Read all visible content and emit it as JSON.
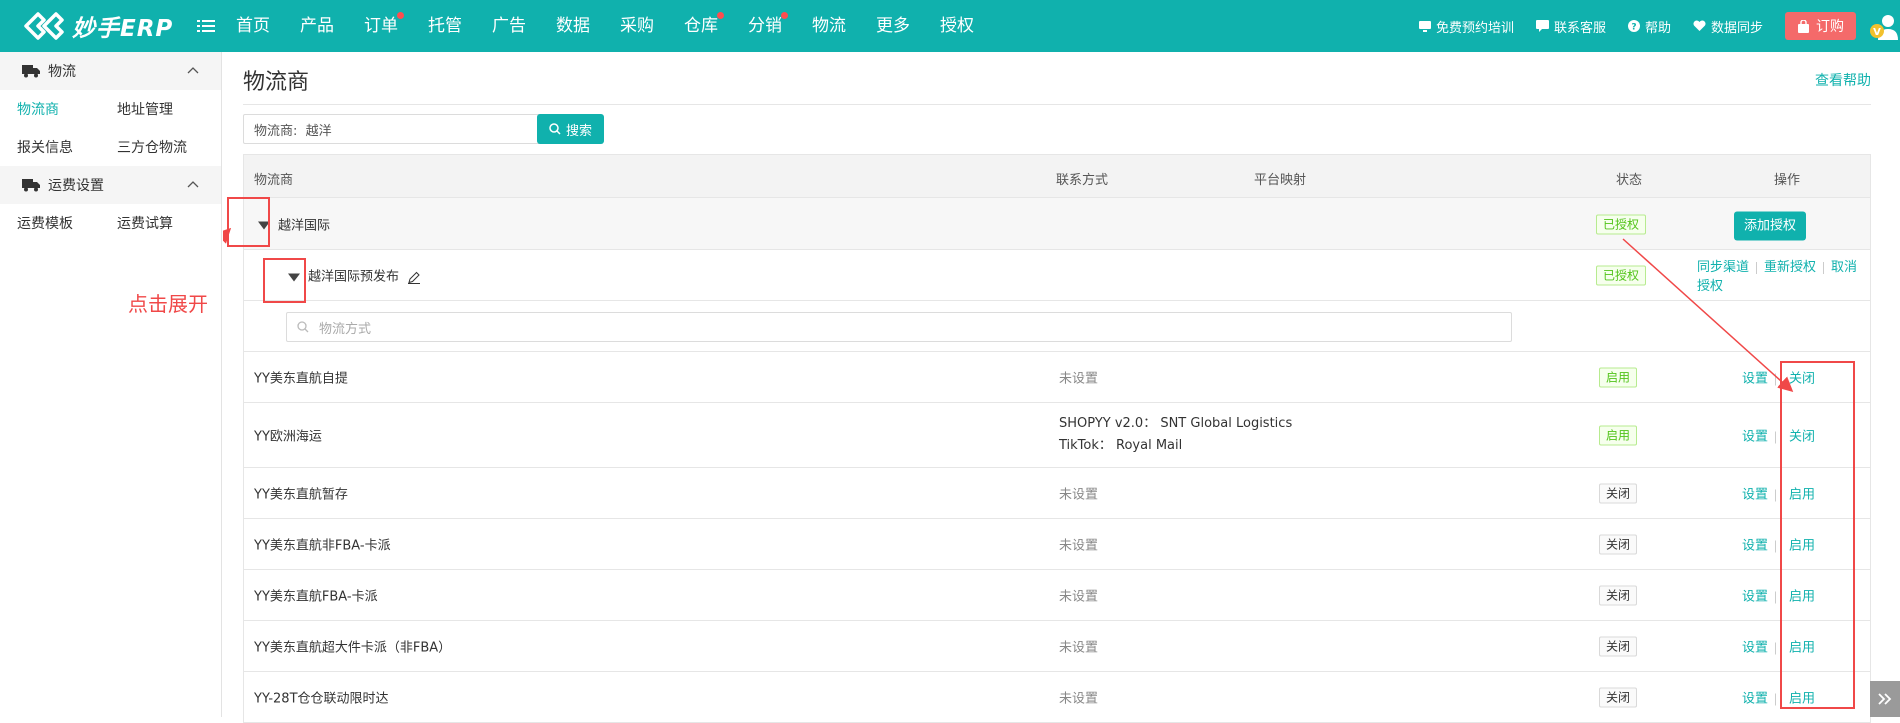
{
  "app": {
    "logo_text": "妙手ERP"
  },
  "nav": {
    "items": [
      {
        "label": "首页",
        "dot": false
      },
      {
        "label": "产品",
        "dot": false
      },
      {
        "label": "订单",
        "dot": true
      },
      {
        "label": "托管",
        "dot": false
      },
      {
        "label": "广告",
        "dot": false
      },
      {
        "label": "数据",
        "dot": false
      },
      {
        "label": "采购",
        "dot": false
      },
      {
        "label": "仓库",
        "dot": true
      },
      {
        "label": "分销",
        "dot": true
      },
      {
        "label": "物流",
        "dot": false
      },
      {
        "label": "更多",
        "dot": false
      },
      {
        "label": "授权",
        "dot": false
      }
    ]
  },
  "header_tools": {
    "training": "免费预约培训",
    "support": "联系客服",
    "help": "帮助",
    "sync": "数据同步",
    "order": "订购"
  },
  "sidebar": {
    "group1": "物流",
    "group1_links": [
      "物流商",
      "地址管理",
      "报关信息",
      "三方仓物流"
    ],
    "group2": "运费设置",
    "group2_links": [
      "运费模板",
      "运费试算"
    ]
  },
  "page": {
    "title": "物流商",
    "help_link": "查看帮助",
    "filter_label": "物流商:",
    "filter_value": "越洋",
    "search_button": "搜索"
  },
  "table": {
    "headers": {
      "carrier": "物流商",
      "contact": "联系方式",
      "mapping": "平台映射",
      "status": "状态",
      "actions": "操作"
    },
    "group": {
      "name": "越洋国际",
      "status": "已授权",
      "action": "添加授权"
    },
    "sub": {
      "name": "越洋国际预发布",
      "status": "已授权",
      "actions": [
        "同步渠道",
        "重新授权",
        "取消授权"
      ]
    },
    "method_search_placeholder": "物流方式",
    "settings_label": "设置",
    "rows": [
      {
        "name": "YY美东直航自提",
        "mapping": "未设置",
        "mapping2": "",
        "status": "启用",
        "status_color": "green",
        "toggle": "关闭"
      },
      {
        "name": "YY欧洲海运",
        "mapping": "SHOPYY v2.0： SNT Global Logistics",
        "mapping2": "TikTok： Royal Mail",
        "status": "启用",
        "status_color": "green",
        "toggle": "关闭"
      },
      {
        "name": "YY美东直航暂存",
        "mapping": "未设置",
        "mapping2": "",
        "status": "关闭",
        "status_color": "gray",
        "toggle": "启用"
      },
      {
        "name": "YY美东直航非FBA-卡派",
        "mapping": "未设置",
        "mapping2": "",
        "status": "关闭",
        "status_color": "gray",
        "toggle": "启用"
      },
      {
        "name": "YY美东直航FBA-卡派",
        "mapping": "未设置",
        "mapping2": "",
        "status": "关闭",
        "status_color": "gray",
        "toggle": "启用"
      },
      {
        "name": "YY美东直航超大件卡派（非FBA）",
        "mapping": "未设置",
        "mapping2": "",
        "status": "关闭",
        "status_color": "gray",
        "toggle": "启用"
      },
      {
        "name": "YY-28T仓仓联动限时达",
        "mapping": "未设置",
        "mapping2": "",
        "status": "关闭",
        "status_color": "gray",
        "toggle": "启用"
      }
    ]
  },
  "annotation": {
    "text": "点击展开"
  },
  "colors": {
    "brand": "#10b1ad",
    "danger": "#f04848",
    "enabled": "#52c41a"
  }
}
